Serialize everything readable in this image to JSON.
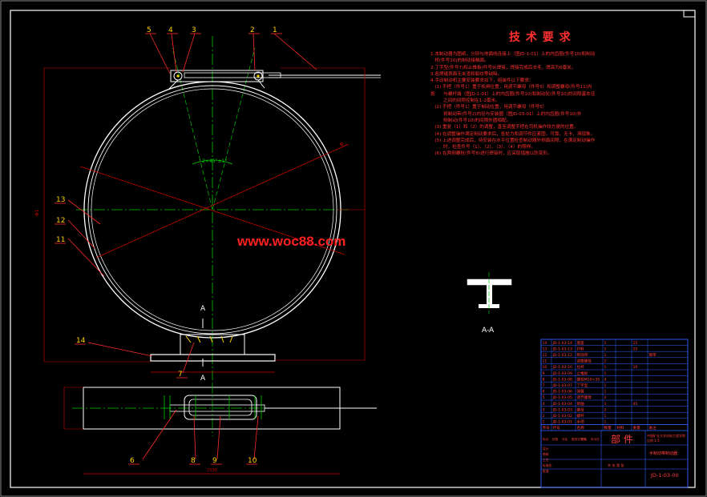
{
  "colors": {
    "background": "#000000",
    "frame": "#ffffff",
    "centerline": "#00c800",
    "dimension": "#c80000",
    "leader": "#ff2a2a",
    "leader_number": "#ffd000",
    "tech_text": "#ff3030",
    "table_line": "#3060ff",
    "table_text": "#ff4040",
    "watermark": "#ff2020"
  },
  "tech_requirements": {
    "title": "技 术 要 求",
    "lines": [
      "1.本制动器为图纸，分别与地面线连接上（图JD-1-01）上的内齿圈(件号10)和制动",
      "   桥(件号10)的制动接触面。",
      "2.丁字型(件号7)和止推板(件号9)焊接，焊接完成后去毛，焊高为6毫米。",
      "3.各焊缝表面无夹渣和裂纹等缺陷。",
      "4.手动制动机主要安装要求如下，组装件以下要求：",
      "   (1) 手把（件号1）置于松闸位置，用调节螺母（件号5）和调整螺母(件号11)内",
      "按      与螺杆端（图JD-1-01）上的内齿圈(件号10)和制动轮(件号10)的间隙基本径",
      "         之间的间隙控制在1-2毫米。",
      "   (2) 手把（件号1）置于制动位置，用调节螺母（件号5）",
      "         将制动带(件号2)内径与安装圈（图JD-03-01）上的内齿圈(件号10)外",
      "         侧制动(件号10)的间隙外圆相配。",
      "   (3) 重复（1）和（2）的调整，直至调整手把在司机操作较方便的位置。",
      "   (4) 在调整操作满足制动要求后，各处力和调节件应紧固，可靠、无卡、滞现象。",
      "   (5) 上述调整完成后，待安装在水平位置检查制动器外侧面间隙，在满足制动操作",
      "         时，检查件号（1）、（2）、（3）、（4）的照样。",
      "   (6) 在两侧螺栓(件号8)进行焊接时，应采取措施以防变形。"
    ]
  },
  "watermark": "www.woc88.com",
  "labels": {
    "section_a_top": "A",
    "section_a_bottom": "A",
    "section_view": "A-A",
    "angle_note": "2×45°±1°",
    "dim_total": "2330",
    "dim_side": "Φ1",
    "dim_right": "Φ",
    "dim_bottom": "2330"
  },
  "part_numbers": [
    {
      "num": "1",
      "name": "手把"
    },
    {
      "num": "2",
      "name": "螺杆"
    },
    {
      "num": "3",
      "name": "螺母"
    },
    {
      "num": "4",
      "name": "销轴"
    },
    {
      "num": "5",
      "name": "调节螺母"
    },
    {
      "num": "6",
      "name": "弹簧"
    },
    {
      "num": "7",
      "name": "丁字型"
    },
    {
      "num": "8",
      "name": "螺栓"
    },
    {
      "num": "9",
      "name": "止推板"
    },
    {
      "num": "10",
      "name": "拉杆"
    },
    {
      "num": "11",
      "name": "调整螺母"
    },
    {
      "num": "12",
      "name": "制动带"
    },
    {
      "num": "13",
      "name": "衬料"
    },
    {
      "num": "14",
      "name": "底座"
    }
  ],
  "parts_table": {
    "rows": [
      [
        "14",
        "JD-1-03-14",
        "底座",
        "1",
        "",
        "15",
        ""
      ],
      [
        "13",
        "JD-1-03-13",
        "衬料",
        "1",
        "",
        "25",
        ""
      ],
      [
        "12",
        "JD-1-03-12",
        "制动带",
        "1",
        "",
        "",
        "钢带"
      ],
      [
        "11",
        "",
        "调整螺母",
        "2",
        "",
        "",
        ""
      ],
      [
        "10",
        "JD-1-03-10",
        "拉杆",
        "1",
        "",
        "16",
        ""
      ],
      [
        "9",
        "JD-1-03-09",
        "止推板",
        "1",
        "",
        "",
        ""
      ],
      [
        "8",
        "JD-1-03-08",
        "螺栓M10×35",
        "4",
        "",
        "",
        ""
      ],
      [
        "7",
        "JD-1-03-07",
        "丁字型",
        "1",
        "",
        "",
        ""
      ],
      [
        "6",
        "JD-1-03-06",
        "弹簧",
        "1",
        "",
        "",
        ""
      ],
      [
        "5",
        "JD-1-03-05",
        "调节螺母",
        "2",
        "",
        "",
        ""
      ],
      [
        "4",
        "JD-1-03-04",
        "销轴",
        "1",
        "",
        "45",
        ""
      ],
      [
        "3",
        "JD-1-03-03",
        "螺母",
        "2",
        "",
        "",
        ""
      ],
      [
        "2",
        "JD-1-03-02",
        "螺杆",
        "1",
        "",
        "",
        ""
      ],
      [
        "1",
        "JD-1-03-01",
        "手把",
        "1",
        "",
        "",
        ""
      ]
    ],
    "header": [
      "序号",
      "代号",
      "名称",
      "数量",
      "材料",
      "重量",
      "备注"
    ]
  },
  "title_block": {
    "big_label": "部 件",
    "drawing_name": "手制动带制动器",
    "drawing_number": "JD-1-03-00",
    "company": "中国矿业大学机电工程学院",
    "scale_label": "比例 1:5",
    "sheet": "共 张 第 张",
    "sign_labels": [
      "标记",
      "处数",
      "分区",
      "更改文件号",
      "签名",
      "年月日"
    ],
    "role_labels": [
      "设计",
      "审核",
      "工艺",
      "标准化",
      "批准"
    ]
  }
}
